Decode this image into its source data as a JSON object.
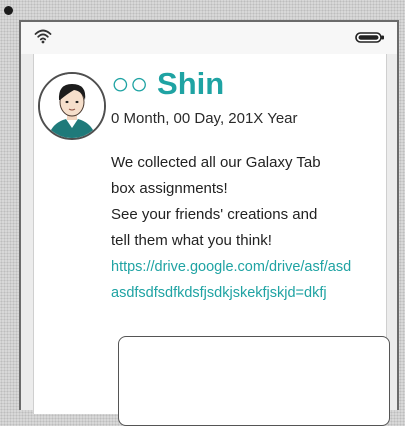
{
  "post": {
    "author": "○○ Shin",
    "date": "0 Month, 00 Day, 201X Year",
    "lines": [
      "We collected all our Galaxy Tab",
      "box assignments!",
      "See your friends' creations and",
      "tell them what you think!"
    ],
    "link_lines": [
      "https://drive.google.com/drive/asf/asd",
      "asdfsdfsdfkdsfjsdkjskekfjskjd=dkfj"
    ]
  },
  "icons": {
    "wifi": "wifi-icon",
    "battery": "battery-icon",
    "avatar": "avatar"
  },
  "colors": {
    "accent": "#1fa3a3",
    "background": "#d9d9d9"
  }
}
